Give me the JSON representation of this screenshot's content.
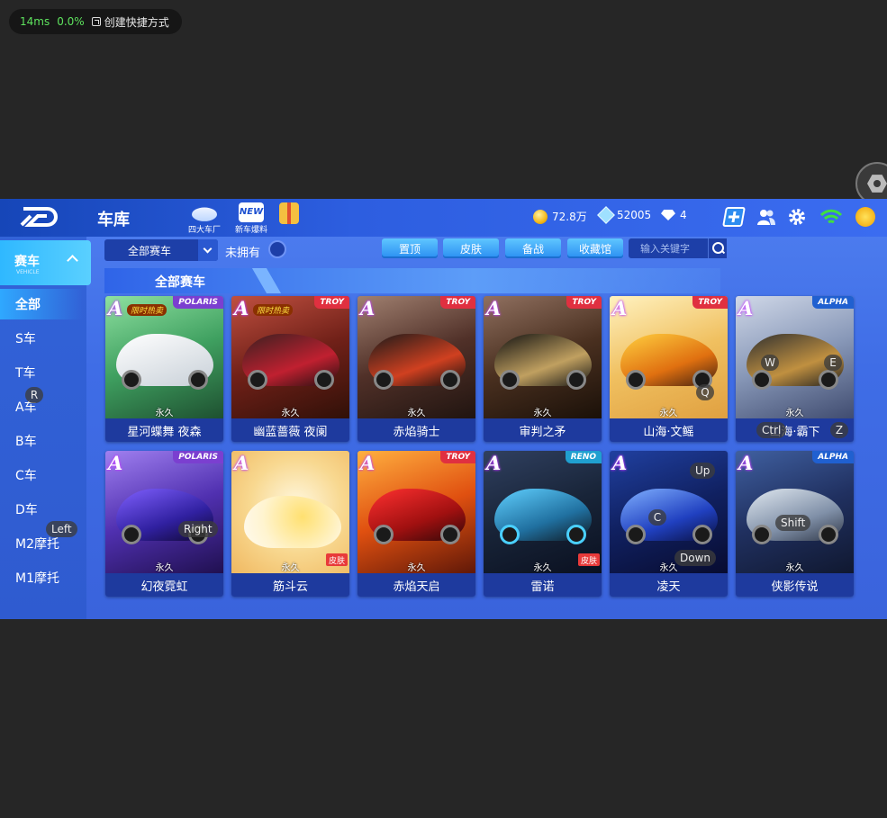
{
  "overlay": {
    "latency": "14ms",
    "loss": "0.0%",
    "shortcut_label": "创建快捷方式"
  },
  "header": {
    "title": "车库",
    "icons": [
      {
        "label": "四大车厂",
        "icon": "car-factory-icon"
      },
      {
        "label": "新车爆料",
        "icon": "new-badge-icon"
      },
      {
        "label": "",
        "icon": "gift-box-icon"
      }
    ],
    "coins": "72.8万",
    "gems": "52005",
    "diamonds": "4"
  },
  "sidebar": {
    "category": "赛车",
    "category_sub": "VEHICLE",
    "items": [
      "全部",
      "S车",
      "T车",
      "A车",
      "B车",
      "C车",
      "D车",
      "M2摩托",
      "M1摩托"
    ]
  },
  "filters": {
    "dropdown_value": "全部赛车",
    "owned_label": "未拥有",
    "buttons": [
      "置顶",
      "皮肤",
      "备战",
      "收藏馆"
    ],
    "search_placeholder": "输入关键字"
  },
  "section_title": "全部赛车",
  "cards": [
    {
      "rank": "A",
      "brand": "POLARIS",
      "promo": "限时热卖",
      "status": "永久",
      "name": "星河蝶舞 夜森"
    },
    {
      "rank": "A",
      "brand": "TROY",
      "promo": "限时热卖",
      "status": "永久",
      "name": "幽蓝蔷薇 夜阑"
    },
    {
      "rank": "A",
      "brand": "TROY",
      "status": "永久",
      "name": "赤焰骑士"
    },
    {
      "rank": "A",
      "brand": "TROY",
      "status": "永久",
      "name": "审判之矛"
    },
    {
      "rank": "A",
      "brand": "TROY",
      "status": "永久",
      "name": "山海·文鳐"
    },
    {
      "rank": "A",
      "brand": "ALPHA",
      "status": "永久",
      "name": "山海·霸下"
    },
    {
      "rank": "A",
      "brand": "POLARIS",
      "status": "永久",
      "name": "幻夜霓虹"
    },
    {
      "rank": "A",
      "status": "永久",
      "skin": "皮肤",
      "name": "筋斗云"
    },
    {
      "rank": "A",
      "brand": "TROY",
      "status": "永久",
      "name": "赤焰天启"
    },
    {
      "rank": "A",
      "brand": "RENO",
      "status": "永久",
      "skin": "皮肤",
      "name": "雷诺"
    },
    {
      "rank": "A",
      "status": "永久",
      "name": "凌天"
    },
    {
      "rank": "A",
      "brand": "ALPHA",
      "status": "永久",
      "name": "侠影传说"
    }
  ],
  "key_hints": [
    "R",
    "Left",
    "Right",
    "Q",
    "W",
    "E",
    "Ctrl",
    "Z",
    "Up",
    "C",
    "Down",
    "Shift"
  ],
  "colors": {
    "card_names_bg": "#1e3a9e",
    "accent": "#2fa8ff",
    "skin_badge": "#e83a3a"
  }
}
